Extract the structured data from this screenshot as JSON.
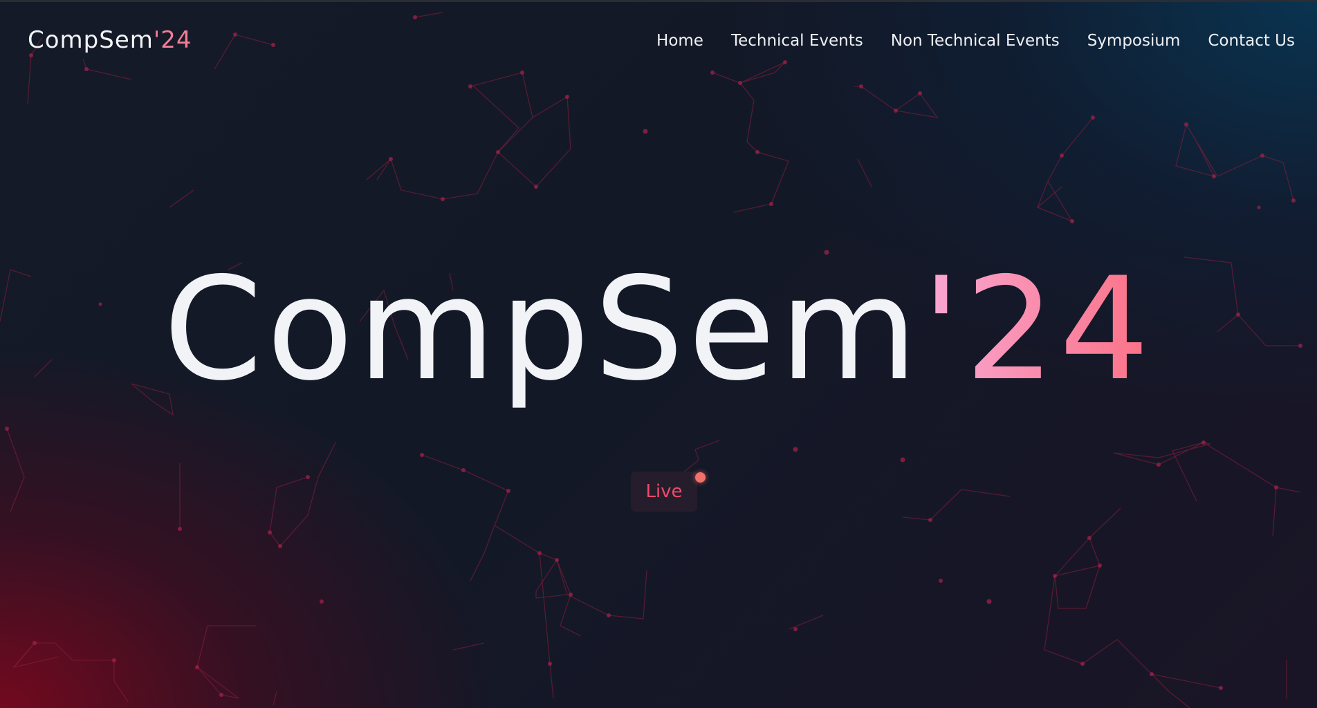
{
  "brand": {
    "name": "CompSem",
    "year": "'24"
  },
  "nav": {
    "items": [
      {
        "label": "Home"
      },
      {
        "label": "Technical Events"
      },
      {
        "label": "Non Technical Events"
      },
      {
        "label": "Symposium"
      },
      {
        "label": "Contact Us"
      }
    ]
  },
  "hero": {
    "title": "CompSem",
    "year": "'24"
  },
  "live_badge": {
    "label": "Live"
  },
  "colors": {
    "background": "#0f1421",
    "text": "#f1f3f6",
    "accent_pink": "#f9a8d4",
    "accent_coral": "#fb7185",
    "live_text": "#f04a6a",
    "live_dot": "#f4706a",
    "constellation": "#8a1f3c"
  }
}
